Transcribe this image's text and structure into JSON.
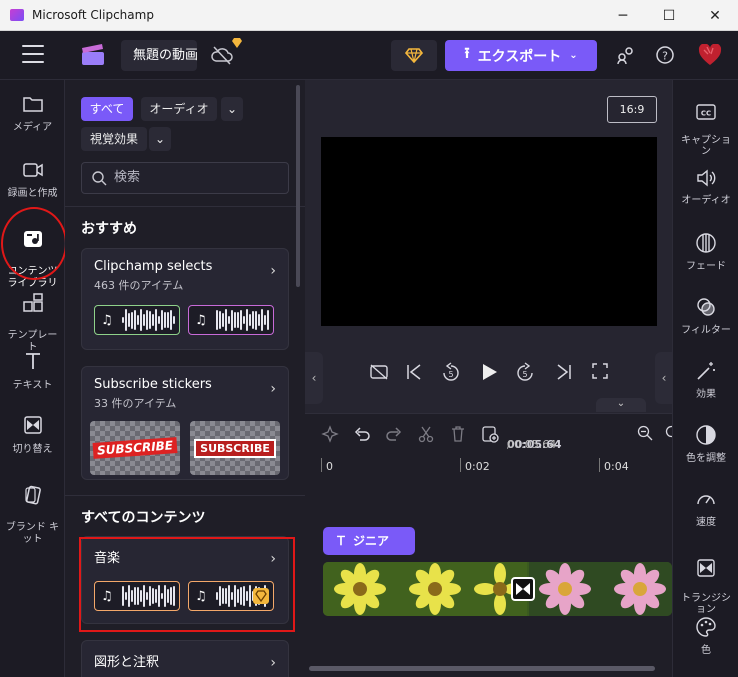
{
  "window": {
    "title": "Microsoft Clipchamp",
    "minimize": "─",
    "maximize": "☐",
    "close": "✕"
  },
  "topbar": {
    "project_name": "無題の動画",
    "export_label": "エクスポート"
  },
  "left_nav": [
    {
      "label": "メディア",
      "icon": "folder-icon"
    },
    {
      "label": "録画と作成",
      "icon": "camera-icon"
    },
    {
      "label": "コンテンツ\nライブラリ",
      "icon": "content-library-icon"
    },
    {
      "label": "テンプレー\nト",
      "icon": "templates-icon"
    },
    {
      "label": "テキスト",
      "icon": "text-icon"
    },
    {
      "label": "切り替え",
      "icon": "transitions-icon"
    },
    {
      "label": "ブランド キ\nット",
      "icon": "brand-kit-icon"
    }
  ],
  "filters": {
    "all": "すべて",
    "audio": "オーディオ",
    "visual": "視覚効果"
  },
  "search": {
    "placeholder": "検索"
  },
  "recommended": {
    "heading": "おすすめ",
    "cards": [
      {
        "title": "Clipchamp selects",
        "subtitle": "463 件のアイテム"
      },
      {
        "title": "Subscribe stickers",
        "subtitle": "33 件のアイテム",
        "stickers": [
          "SUBSCRIBE",
          "SUBSCRIBE"
        ]
      }
    ]
  },
  "all_content": {
    "heading": "すべてのコンテンツ",
    "cards": [
      {
        "title": "音楽"
      },
      {
        "title": "図形と注釈"
      }
    ]
  },
  "preview": {
    "aspect_ratio": "16:9"
  },
  "timeline": {
    "current_time": "00:05.64",
    "separator": "/",
    "total_time": "00:05.64",
    "ruler": [
      "0",
      "0:02",
      "0:04"
    ],
    "text_clip": "ジニア"
  },
  "right_nav": [
    {
      "label": "キャプショ\nン",
      "icon": "captions-icon"
    },
    {
      "label": "オーディオ",
      "icon": "audio-icon"
    },
    {
      "label": "フェード",
      "icon": "fade-icon"
    },
    {
      "label": "フィルター",
      "icon": "filter-icon"
    },
    {
      "label": "効果",
      "icon": "effects-icon"
    },
    {
      "label": "色を調整",
      "icon": "adjust-color-icon"
    },
    {
      "label": "速度",
      "icon": "speed-icon"
    },
    {
      "label": "トランジシ\nョン",
      "icon": "transition-icon"
    },
    {
      "label": "色",
      "icon": "color-palette-icon"
    }
  ],
  "colors": {
    "accent": "#7a5af8",
    "highlight": "#e01818",
    "background": "#1f1e27"
  }
}
